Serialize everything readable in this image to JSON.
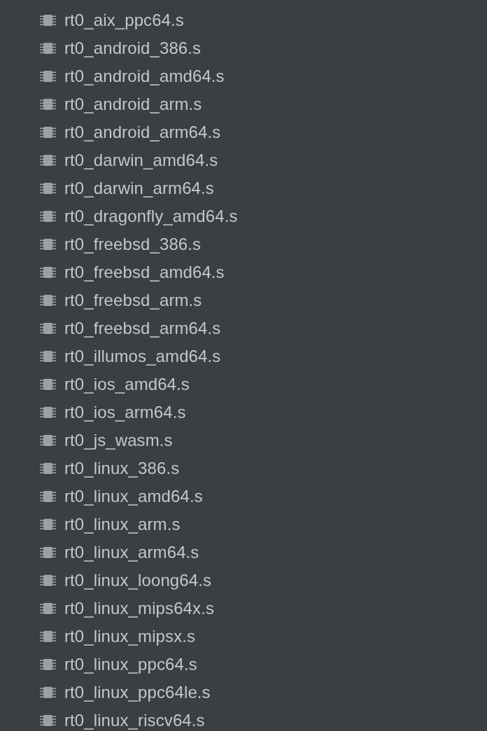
{
  "files": [
    {
      "name": "rt0_aix_ppc64.s",
      "kind": "assembly"
    },
    {
      "name": "rt0_android_386.s",
      "kind": "assembly"
    },
    {
      "name": "rt0_android_amd64.s",
      "kind": "assembly"
    },
    {
      "name": "rt0_android_arm.s",
      "kind": "assembly"
    },
    {
      "name": "rt0_android_arm64.s",
      "kind": "assembly"
    },
    {
      "name": "rt0_darwin_amd64.s",
      "kind": "assembly"
    },
    {
      "name": "rt0_darwin_arm64.s",
      "kind": "assembly"
    },
    {
      "name": "rt0_dragonfly_amd64.s",
      "kind": "assembly"
    },
    {
      "name": "rt0_freebsd_386.s",
      "kind": "assembly"
    },
    {
      "name": "rt0_freebsd_amd64.s",
      "kind": "assembly"
    },
    {
      "name": "rt0_freebsd_arm.s",
      "kind": "assembly"
    },
    {
      "name": "rt0_freebsd_arm64.s",
      "kind": "assembly"
    },
    {
      "name": "rt0_illumos_amd64.s",
      "kind": "assembly"
    },
    {
      "name": "rt0_ios_amd64.s",
      "kind": "assembly"
    },
    {
      "name": "rt0_ios_arm64.s",
      "kind": "assembly"
    },
    {
      "name": "rt0_js_wasm.s",
      "kind": "assembly"
    },
    {
      "name": "rt0_linux_386.s",
      "kind": "assembly"
    },
    {
      "name": "rt0_linux_amd64.s",
      "kind": "assembly"
    },
    {
      "name": "rt0_linux_arm.s",
      "kind": "assembly"
    },
    {
      "name": "rt0_linux_arm64.s",
      "kind": "assembly"
    },
    {
      "name": "rt0_linux_loong64.s",
      "kind": "assembly"
    },
    {
      "name": "rt0_linux_mips64x.s",
      "kind": "assembly"
    },
    {
      "name": "rt0_linux_mipsx.s",
      "kind": "assembly"
    },
    {
      "name": "rt0_linux_ppc64.s",
      "kind": "assembly"
    },
    {
      "name": "rt0_linux_ppc64le.s",
      "kind": "assembly"
    },
    {
      "name": "rt0_linux_riscv64.s",
      "kind": "assembly"
    }
  ]
}
